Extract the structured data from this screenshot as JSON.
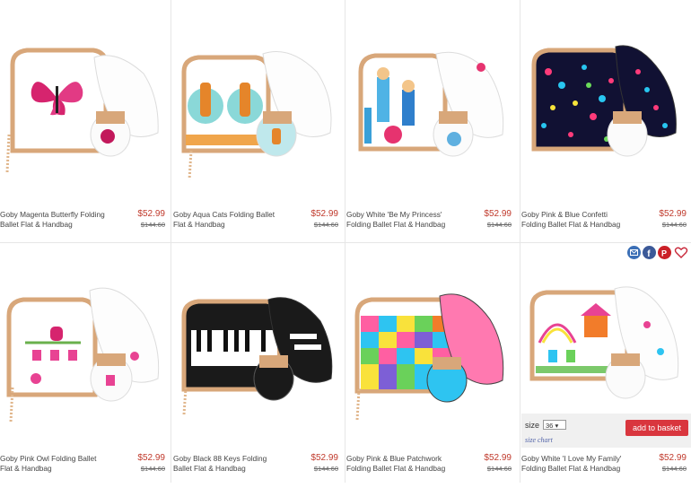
{
  "products": [
    {
      "name": "Goby Magenta Butterfly Folding Ballet Flat & Handbag",
      "price": "$52.99",
      "was": "$144.60"
    },
    {
      "name": "Goby Aqua Cats Folding Ballet Flat & Handbag",
      "price": "$52.99",
      "was": "$144.60"
    },
    {
      "name": "Goby White 'Be My Princess' Folding Ballet Flat & Handbag",
      "price": "$52.99",
      "was": "$144.60"
    },
    {
      "name": "Goby Pink & Blue Confetti Folding Ballet Flat & Handbag",
      "price": "$52.99",
      "was": "$144.60"
    },
    {
      "name": "Goby Pink Owl Folding Ballet Flat & Handbag",
      "price": "$52.99",
      "was": "$144.60"
    },
    {
      "name": "Goby Black 88 Keys Folding Ballet Flat & Handbag",
      "price": "$52.99",
      "was": "$144.60"
    },
    {
      "name": "Goby Pink & Blue Patchwork Folding Ballet Flat & Handbag",
      "price": "$52.99",
      "was": "$144.60"
    },
    {
      "name": "Goby White 'I Love My Family' Folding Ballet Flat & Handbag",
      "price": "$52.99",
      "was": "$144.60"
    }
  ],
  "quick_buy": {
    "size_label": "size",
    "size_value": "36",
    "add_label": "add to basket",
    "size_chart_label": "size chart"
  },
  "share_icons": [
    "email-icon",
    "facebook-icon",
    "pinterest-icon",
    "heart-icon"
  ],
  "colors": {
    "price": "#c0392b",
    "button": "#d9363e"
  }
}
